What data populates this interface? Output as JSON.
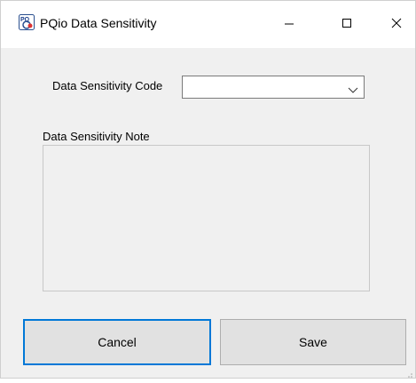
{
  "window": {
    "title": "PQio Data Sensitivity",
    "app_icon": "pqio-app-icon",
    "controls": {
      "minimize_icon": "minimize-icon",
      "maximize_icon": "maximize-icon",
      "close_icon": "close-icon"
    }
  },
  "form": {
    "code_label": "Data Sensitivity Code",
    "code_value": "",
    "code_dropdown_icon": "chevron-down-icon",
    "note_label": "Data Sensitivity Note",
    "note_value": ""
  },
  "buttons": {
    "cancel_label": "Cancel",
    "save_label": "Save"
  },
  "colors": {
    "window_bg": "#f0f0f0",
    "titlebar_bg": "#ffffff",
    "focus_border": "#0078d7",
    "button_bg": "#e1e1e1"
  }
}
